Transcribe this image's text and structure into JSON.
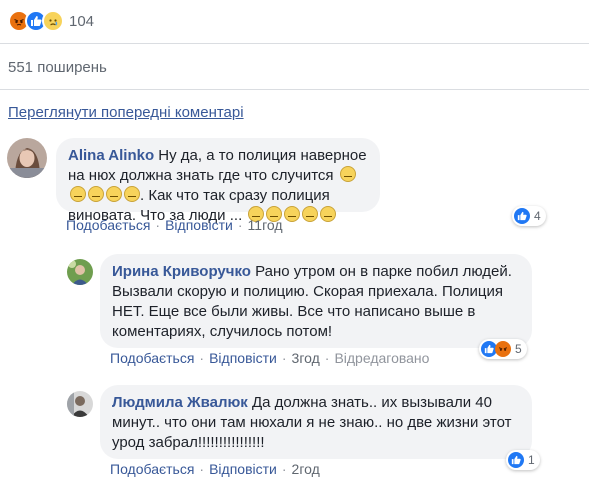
{
  "reactions_top": {
    "icons": [
      "angry-icon",
      "like-icon",
      "sad-icon"
    ],
    "count": "104"
  },
  "shares": "551 поширень",
  "view_previous": "Переглянути попередні коментарі",
  "colors": {
    "link": "#385898",
    "like": "#2078f4",
    "angry": "#e9710f",
    "bubble": "#f2f3f5"
  },
  "comments": [
    {
      "author": "Alina Alinko",
      "text_1": "Ну да, а то полиция наверное на нюх должна знать где что случится",
      "text_2": ". Как что так сразу полиция виновата. Что за люди ...",
      "like_label": "Подобається",
      "reply_label": "Відповісти",
      "time": "11год",
      "reaction_count": "4"
    },
    {
      "author": "Ирина Криворучко",
      "text": "Рано утром он в парке побил людей. Вызвали скорую и полицию. Скорая приехала. Полиция НЕТ. Еще все были живы. Все что написано выше в коментариях, случилось потом!",
      "like_label": "Подобається",
      "reply_label": "Відповісти",
      "time": "3год",
      "edited": "Відредаговано",
      "reaction_count": "5"
    },
    {
      "author": "Людмила Жвалюк",
      "text": "Да должна знать.. их вызывали 40 минут.. что они там нюхали я не знаю.. но две жизни этот урод забрал!!!!!!!!!!!!!!!!",
      "like_label": "Подобається",
      "reply_label": "Відповісти",
      "time": "2год",
      "reaction_count": "1"
    }
  ]
}
